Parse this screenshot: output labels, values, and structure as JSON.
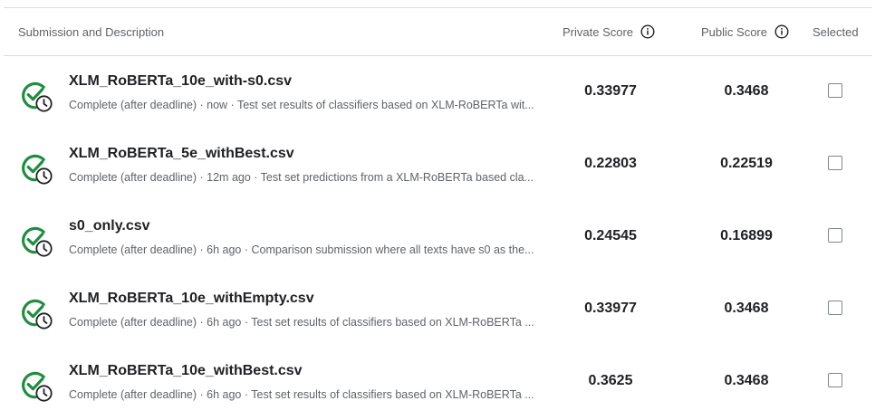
{
  "header": {
    "description": "Submission and Description",
    "private_score": "Private Score",
    "public_score": "Public Score",
    "selected": "Selected"
  },
  "colors": {
    "success": "#1e8e3e",
    "text": "#202124",
    "muted": "#5f6368",
    "border": "#dadce0"
  },
  "icons": {
    "status": "check-with-clock-icon",
    "info": "info-icon",
    "checkbox": "checkbox-unchecked"
  },
  "rows": [
    {
      "name": "XLM_RoBERTa_10e_with-s0.csv",
      "description": "Complete (after deadline) · now · Test set results of classifiers based on XLM-RoBERTa wit...",
      "private_score": "0.33977",
      "public_score": "0.3468",
      "selected": false
    },
    {
      "name": "XLM_RoBERTa_5e_withBest.csv",
      "description": "Complete (after deadline) · 12m ago · Test set predictions from a XLM-RoBERTa based cla...",
      "private_score": "0.22803",
      "public_score": "0.22519",
      "selected": false
    },
    {
      "name": "s0_only.csv",
      "description": "Complete (after deadline) · 6h ago · Comparison submission where all texts have s0 as the...",
      "private_score": "0.24545",
      "public_score": "0.16899",
      "selected": false
    },
    {
      "name": "XLM_RoBERTa_10e_withEmpty.csv",
      "description": "Complete (after deadline) · 6h ago · Test set results of classifiers based on XLM-RoBERTa ...",
      "private_score": "0.33977",
      "public_score": "0.3468",
      "selected": false
    },
    {
      "name": "XLM_RoBERTa_10e_withBest.csv",
      "description": "Complete (after deadline) · 6h ago · Test set results of classifiers based on XLM-RoBERTa ...",
      "private_score": "0.3625",
      "public_score": "0.3468",
      "selected": false
    }
  ]
}
